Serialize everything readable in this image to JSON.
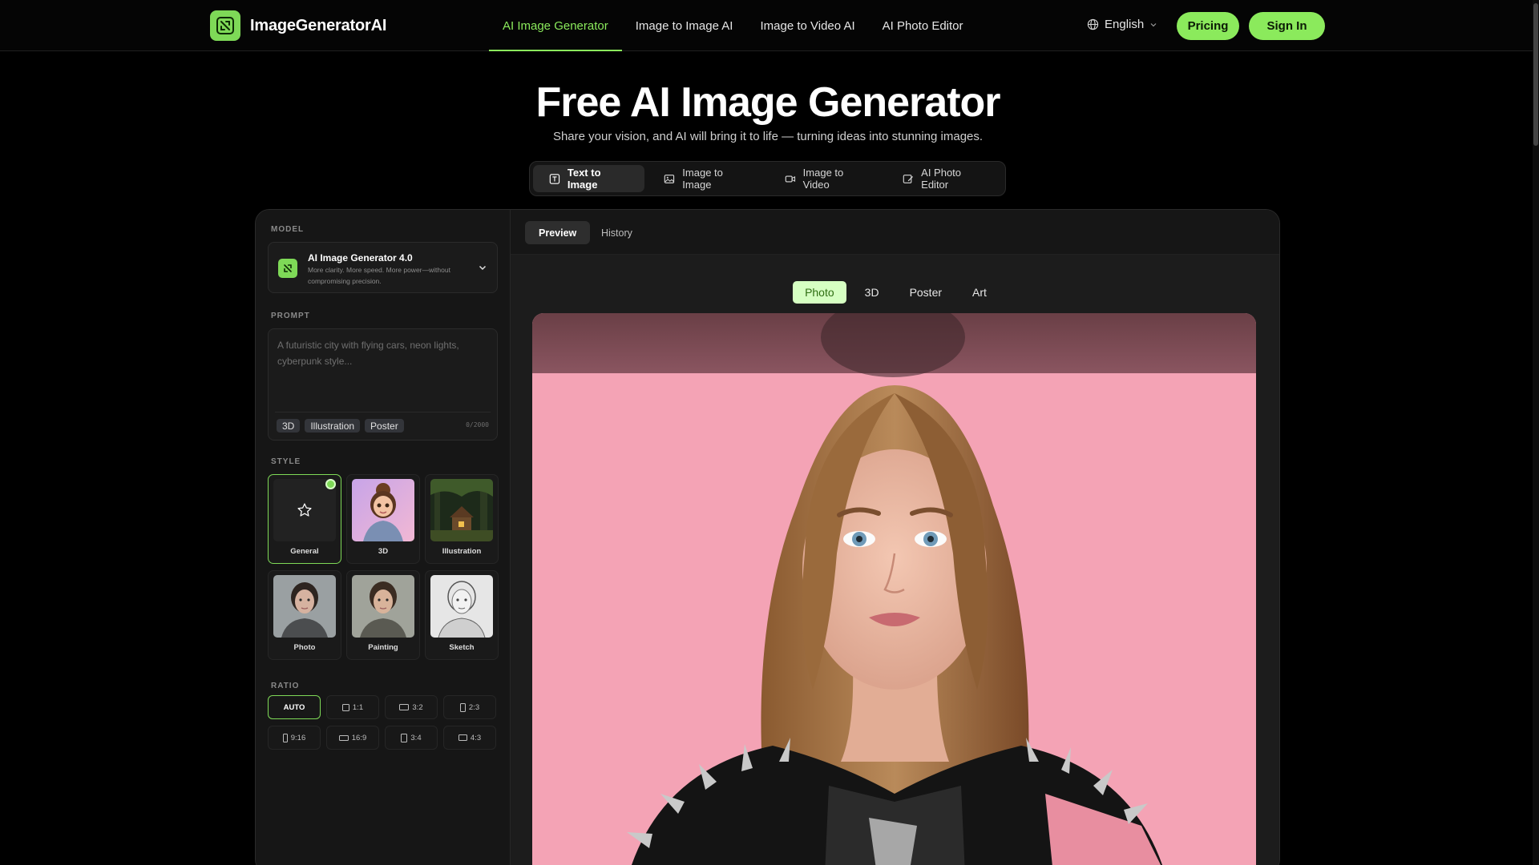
{
  "header": {
    "brand": "ImageGeneratorAI",
    "nav": [
      {
        "label": "AI Image Generator",
        "active": true
      },
      {
        "label": "Image to Image AI"
      },
      {
        "label": "Image to Video AI"
      },
      {
        "label": "AI Photo Editor"
      }
    ],
    "language": "English",
    "pricing_label": "Pricing",
    "signin_label": "Sign In"
  },
  "hero": {
    "title": "Free AI Image Generator",
    "subtitle": "Share your vision, and AI will bring it to life — turning ideas into stunning images."
  },
  "mode_tabs": [
    {
      "label": "Text to Image",
      "icon": "text-icon",
      "active": true
    },
    {
      "label": "Image to Image",
      "icon": "image-icon"
    },
    {
      "label": "Image to Video",
      "icon": "video-icon"
    },
    {
      "label": "AI Photo Editor",
      "icon": "edit-icon"
    }
  ],
  "panel": {
    "model_label": "MODEL",
    "model_name": "AI Image Generator 4.0",
    "model_desc": "More clarity. More speed. More power—without compromising precision.",
    "prompt_label": "PROMPT",
    "prompt_placeholder": "A futuristic city with flying cars, neon lights, cyberpunk style...",
    "prompt_chips": [
      "3D",
      "Illustration",
      "Poster"
    ],
    "char_count": "0/2000",
    "style_label": "STYLE",
    "styles": [
      {
        "name": "General",
        "selected": true
      },
      {
        "name": "3D"
      },
      {
        "name": "Illustration"
      },
      {
        "name": "Photo"
      },
      {
        "name": "Painting"
      },
      {
        "name": "Sketch"
      }
    ],
    "ratio_label": "RATIO",
    "ratios": [
      "AUTO",
      "1:1",
      "3:2",
      "2:3",
      "9:16",
      "16:9",
      "3:4",
      "4:3"
    ],
    "ratio_selected": "AUTO"
  },
  "preview": {
    "tabs": [
      "Preview",
      "History"
    ],
    "active_tab": "Preview",
    "categories": [
      "Photo",
      "3D",
      "Poster",
      "Art"
    ],
    "active_category": "Photo"
  },
  "colors": {
    "accent": "#8bea5c",
    "background": "#000000",
    "panel": "#161616",
    "photo_background": "#f4a3b5"
  }
}
